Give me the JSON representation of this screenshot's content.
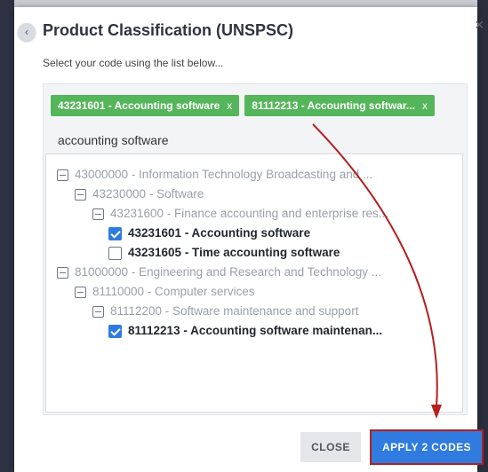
{
  "modal": {
    "title": "Product Classification (UNSPSC)",
    "instruction": "Select your code using the list below...",
    "close_glyph": "×",
    "collapse_glyph": "‹"
  },
  "chips": [
    {
      "label": "43231601 - Accounting software",
      "remove": "x"
    },
    {
      "label": "81112213 - Accounting softwar...",
      "remove": "x"
    }
  ],
  "search": {
    "value": "accounting software"
  },
  "tree": [
    {
      "label": "43000000 - Information Technology Broadcasting and ...",
      "kind": "toggle",
      "style": "dim"
    },
    {
      "label": "43230000 - Software",
      "kind": "toggle",
      "style": "dim"
    },
    {
      "label": "43231600 - Finance accounting and enterprise res...",
      "kind": "toggle",
      "style": "dim"
    },
    {
      "label": "43231601 - Accounting software",
      "kind": "checkbox",
      "checked": true,
      "style": "bold"
    },
    {
      "label": "43231605 - Time accounting software",
      "kind": "checkbox",
      "checked": false,
      "style": "bold"
    },
    {
      "label": "81000000 - Engineering and Research and Technology ...",
      "kind": "toggle",
      "style": "dim"
    },
    {
      "label": "81110000 - Computer services",
      "kind": "toggle",
      "style": "dim"
    },
    {
      "label": "81112200 - Software maintenance and support",
      "kind": "toggle",
      "style": "dim"
    },
    {
      "label": "81112213 - Accounting software maintenan...",
      "kind": "checkbox",
      "checked": true,
      "style": "bold"
    }
  ],
  "buttons": {
    "close": "CLOSE",
    "apply": "APPLY 2 CODES"
  },
  "colors": {
    "chip_green": "#55b55a",
    "checkbox_blue": "#2f7be0",
    "annotation_red": "#b32020"
  }
}
